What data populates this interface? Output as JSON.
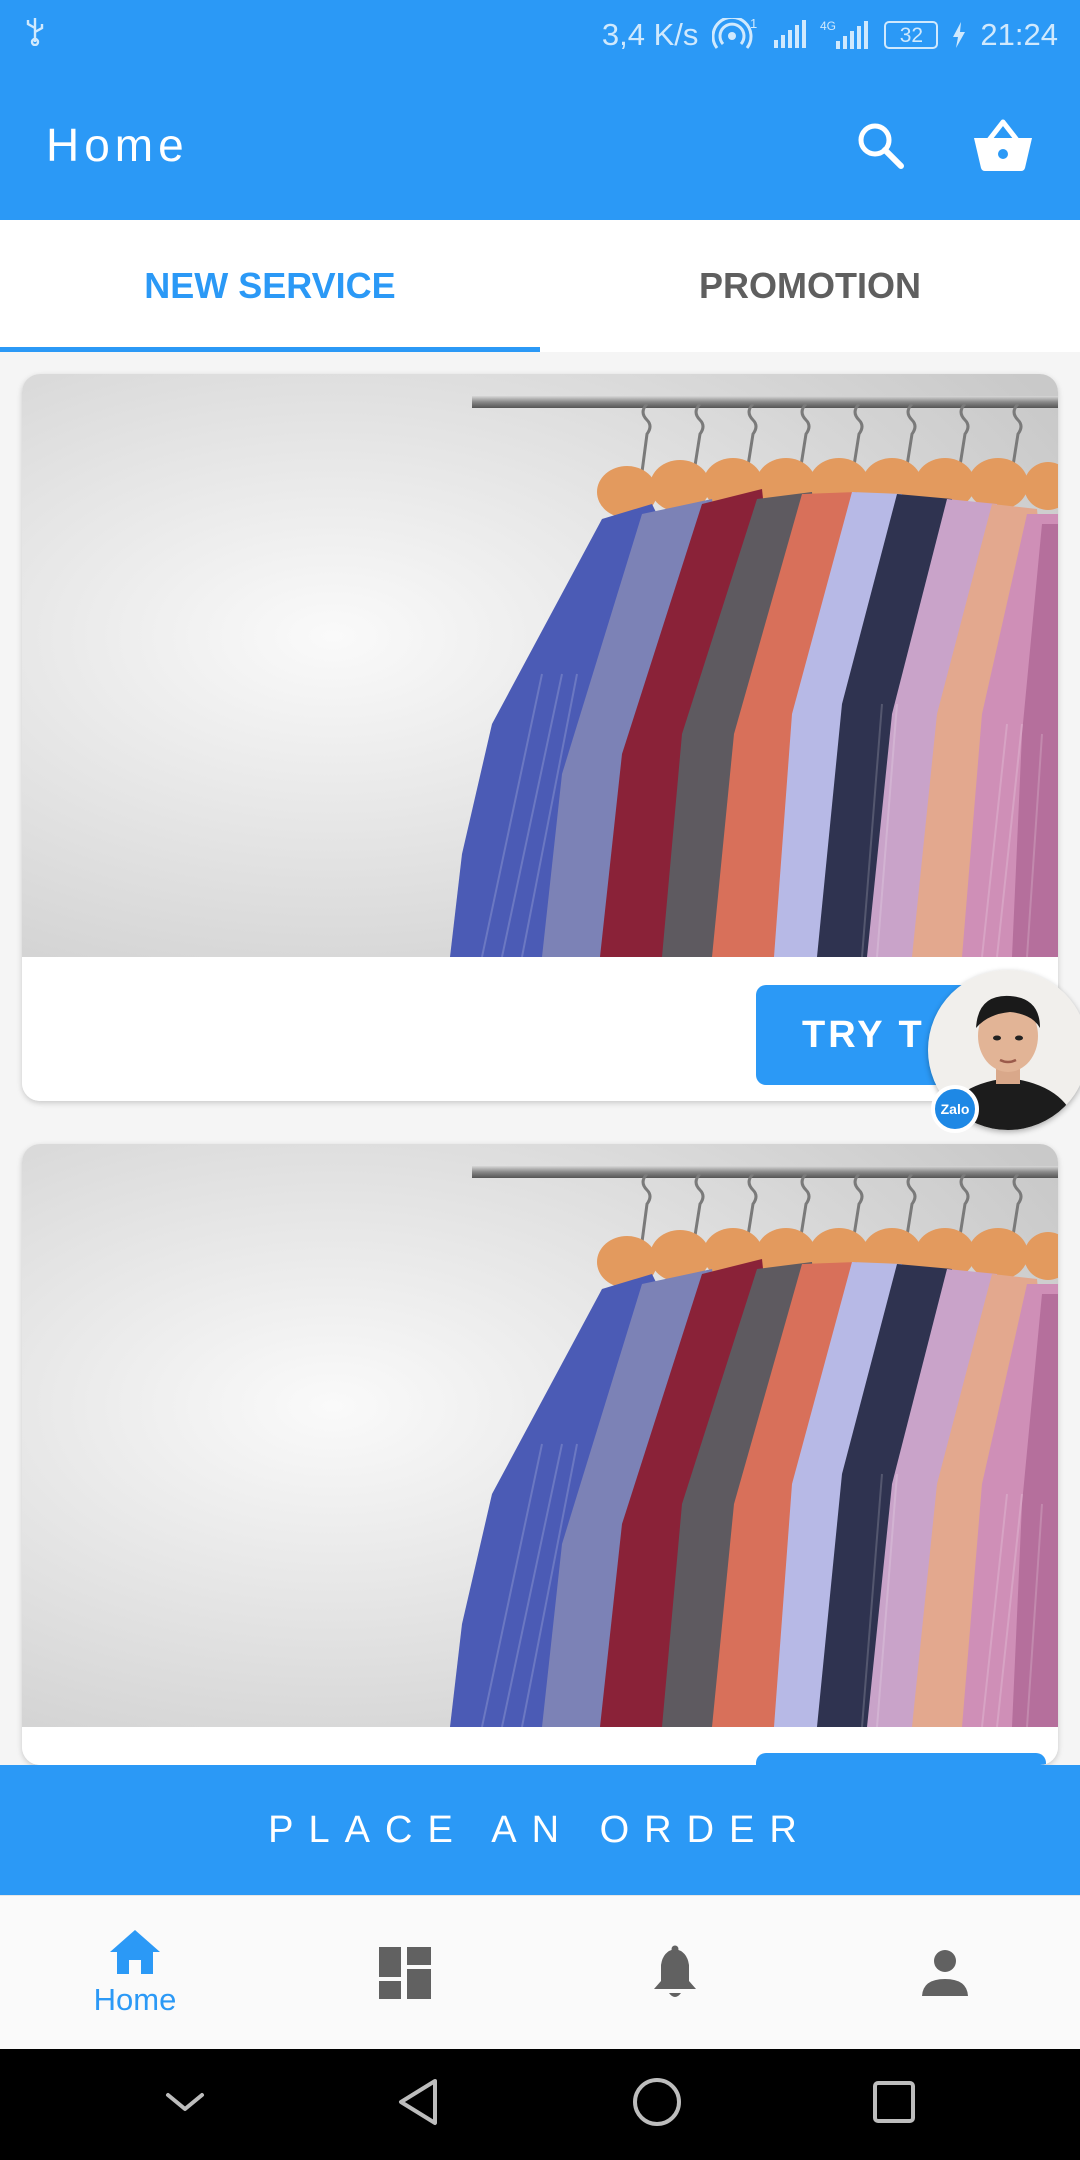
{
  "status_bar": {
    "network_speed": "3,4 K/s",
    "hotspot_count": "1",
    "network_type": "4G",
    "battery": "32",
    "time": "21:24",
    "icons": [
      "usb-icon",
      "hotspot-icon",
      "signal-icon",
      "signal-4g-icon",
      "battery-icon",
      "charging-icon"
    ]
  },
  "app_bar": {
    "title": "Home",
    "actions": [
      "search-icon",
      "basket-icon"
    ]
  },
  "tabs": [
    {
      "label": "NEW SERVICE",
      "active": true
    },
    {
      "label": "PROMOTION",
      "active": false
    }
  ],
  "cards": [
    {
      "image": "shirts-on-hangers",
      "button_label": "TRY T"
    },
    {
      "image": "shirts-on-hangers",
      "button_label": ""
    }
  ],
  "chat": {
    "badge_label": "Zalo"
  },
  "order_bar": {
    "label": "PLACE AN ORDER"
  },
  "bottom_nav": [
    {
      "icon": "home-icon",
      "label": "Home",
      "active": true
    },
    {
      "icon": "dashboard-icon",
      "label": "",
      "active": false
    },
    {
      "icon": "bell-icon",
      "label": "",
      "active": false
    },
    {
      "icon": "person-icon",
      "label": "",
      "active": false
    }
  ],
  "system_nav": [
    "collapse-icon",
    "back-icon",
    "home-circle-icon",
    "recents-icon"
  ],
  "colors": {
    "primary": "#2b99f6",
    "tab_inactive": "#5f5f5f",
    "nav_inactive": "#616161"
  }
}
